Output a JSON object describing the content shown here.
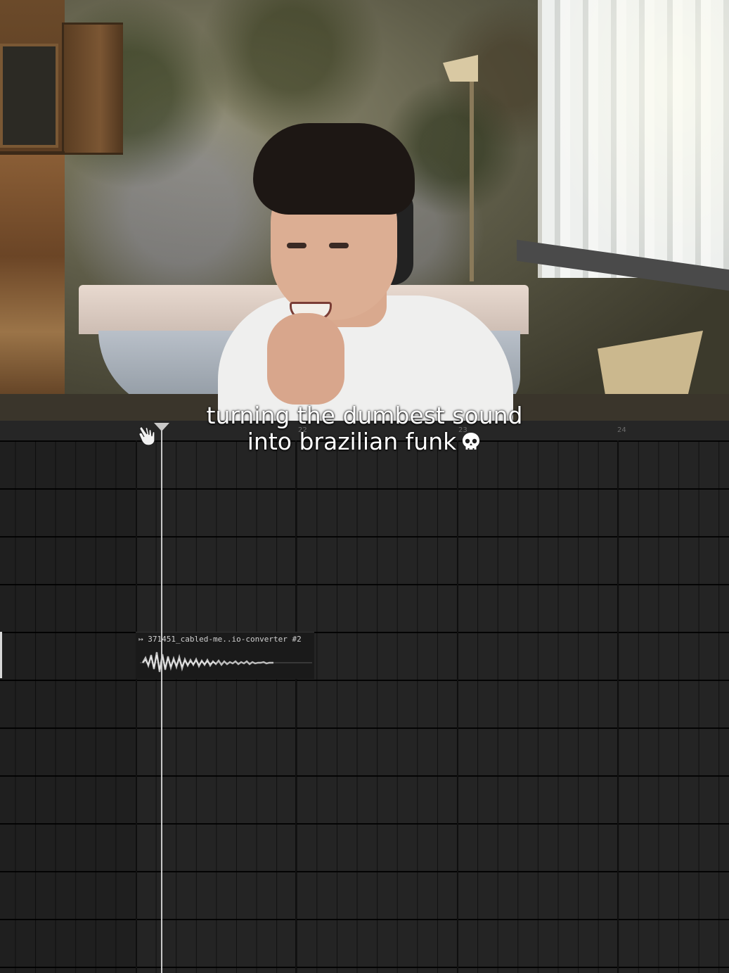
{
  "caption": {
    "line1": "turning the dumbest sound",
    "line2": "into brazilian funk",
    "emoji_icon": "skull-icon"
  },
  "timeline": {
    "bar_numbers": [
      "22",
      "23",
      "24"
    ]
  },
  "clip": {
    "title": "↦ 371451_cabled-me..io-converter #2"
  },
  "colors": {
    "daw_background": "#1e1e1e",
    "playhead": "#c9c9c9",
    "caption_text": "#ffffff"
  }
}
